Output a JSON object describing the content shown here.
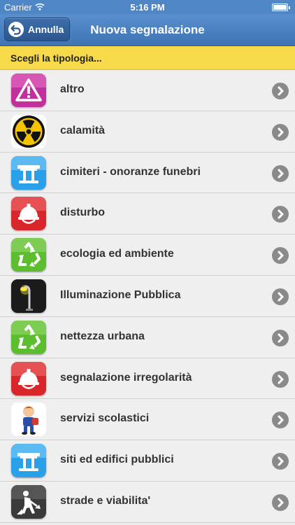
{
  "status_bar": {
    "carrier": "Carrier",
    "time": "5:16 PM"
  },
  "nav": {
    "back_label": "Annulla",
    "title": "Nuova segnalazione"
  },
  "section": {
    "header": "Scegli la tipologia..."
  },
  "categories": [
    {
      "label": "altro",
      "icon": "warning-icon",
      "color": "#c2309e"
    },
    {
      "label": "calamità",
      "icon": "radiation-icon",
      "color": "#f5c400"
    },
    {
      "label": "cimiteri - onoranze funebri",
      "icon": "column-building-icon",
      "color": "#2aa0e8"
    },
    {
      "label": "disturbo",
      "icon": "helmet-icon",
      "color": "#d9262a"
    },
    {
      "label": "ecologia ed ambiente",
      "icon": "recycle-icon",
      "color": "#5cbd2e"
    },
    {
      "label": "Illuminazione Pubblica",
      "icon": "streetlight-icon",
      "color": "#1b1b1b"
    },
    {
      "label": "nettezza urbana",
      "icon": "recycle-icon",
      "color": "#5cbd2e"
    },
    {
      "label": "segnalazione irregolarità",
      "icon": "helmet-icon",
      "color": "#d9262a"
    },
    {
      "label": "servizi scolastici",
      "icon": "schoolboy-icon",
      "color": "#ffffff"
    },
    {
      "label": "siti ed edifici pubblici",
      "icon": "column-building-icon",
      "color": "#2aa0e8"
    },
    {
      "label": "strade e viabilita'",
      "icon": "roadwork-icon",
      "color": "#3a3a3a"
    }
  ]
}
